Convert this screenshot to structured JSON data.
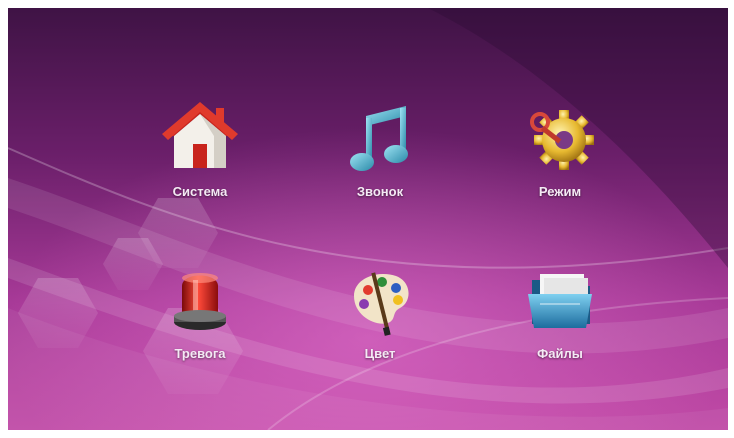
{
  "menu": {
    "items": [
      {
        "label": "Система",
        "icon": "home-icon"
      },
      {
        "label": "Звонок",
        "icon": "music-note-icon"
      },
      {
        "label": "Режим",
        "icon": "gear-icon"
      },
      {
        "label": "Тревога",
        "icon": "alarm-light-icon"
      },
      {
        "label": "Цвет",
        "icon": "palette-icon"
      },
      {
        "label": "Файлы",
        "icon": "folder-icon"
      }
    ]
  },
  "colors": {
    "background_top": "#3f1345",
    "background_bottom": "#c04aa6",
    "label": "#f4eaf4"
  }
}
